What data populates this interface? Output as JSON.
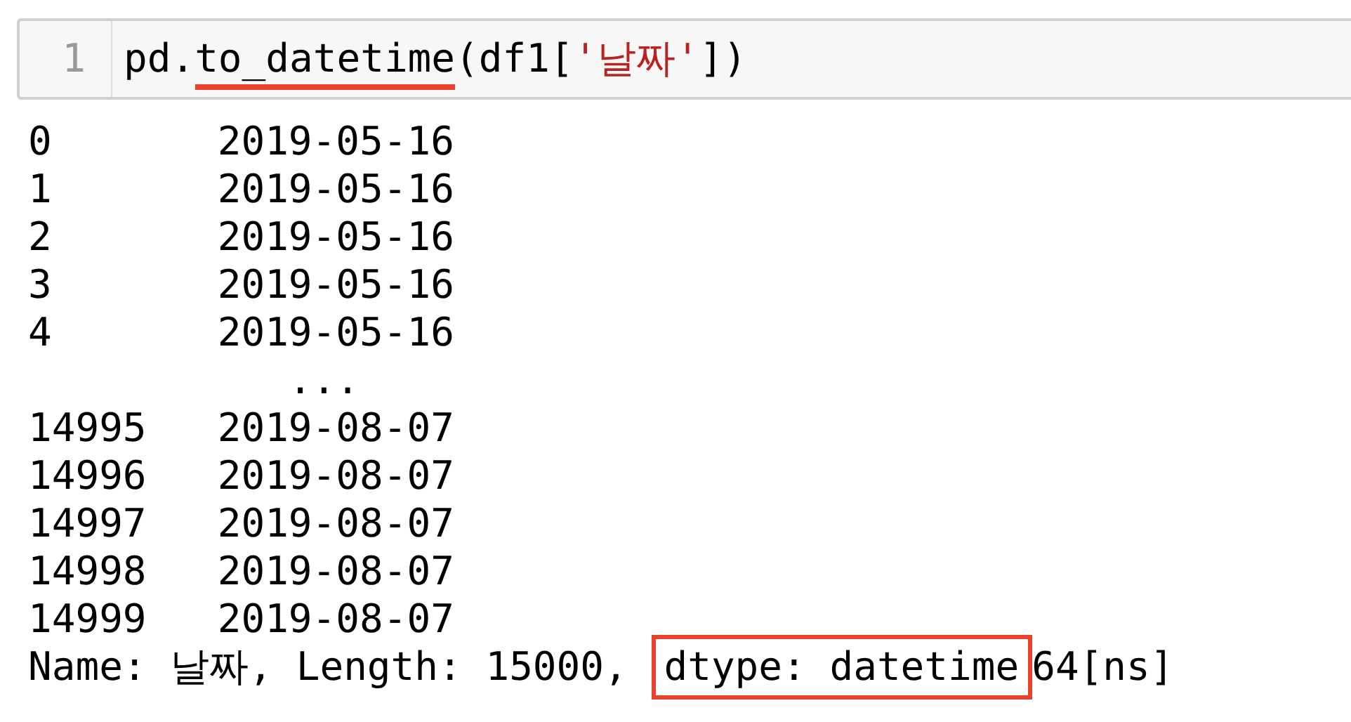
{
  "cell": {
    "prompt": "1",
    "code": [
      {
        "kind": "plain",
        "text": "pd.",
        "underlined": false
      },
      {
        "kind": "plain",
        "text": "to_datetime",
        "underlined": true
      },
      {
        "kind": "plain",
        "text": "(df1[",
        "underlined": false
      },
      {
        "kind": "string",
        "text": "'날짜'",
        "underlined": false
      },
      {
        "kind": "plain",
        "text": "])",
        "underlined": false
      }
    ]
  },
  "output": {
    "rows": [
      {
        "kind": "row",
        "index": "0",
        "value": "2019-05-16"
      },
      {
        "kind": "row",
        "index": "1",
        "value": "2019-05-16"
      },
      {
        "kind": "row",
        "index": "2",
        "value": "2019-05-16"
      },
      {
        "kind": "row",
        "index": "3",
        "value": "2019-05-16"
      },
      {
        "kind": "row",
        "index": "4",
        "value": "2019-05-16"
      },
      {
        "kind": "ellipsis",
        "value": "..."
      },
      {
        "kind": "row",
        "index": "14995",
        "value": "2019-08-07"
      },
      {
        "kind": "row",
        "index": "14996",
        "value": "2019-08-07"
      },
      {
        "kind": "row",
        "index": "14997",
        "value": "2019-08-07"
      },
      {
        "kind": "row",
        "index": "14998",
        "value": "2019-08-07"
      },
      {
        "kind": "row",
        "index": "14999",
        "value": "2019-08-07"
      }
    ],
    "summary": [
      {
        "text": "Name: 날짜, Length: 15000, ",
        "boxed": false
      },
      {
        "text": "dtype: datetime",
        "boxed": true
      },
      {
        "text": "64[ns]",
        "boxed": false
      }
    ]
  }
}
